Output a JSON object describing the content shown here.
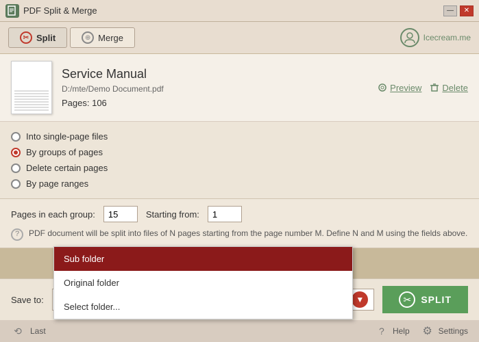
{
  "window": {
    "title": "PDF Split & Merge",
    "app_icon": "PDF",
    "minimize_label": "—",
    "close_label": "✕"
  },
  "tabs": {
    "split_label": "Split",
    "merge_label": "Merge"
  },
  "user": {
    "label": "Icecream.me"
  },
  "file": {
    "title": "Service Manual",
    "path": "D:/mte/Demo Document.pdf",
    "pages_label": "Pages: 106",
    "preview_label": "Preview",
    "delete_label": "Delete"
  },
  "split_options": {
    "option1_label": "Into single-page files",
    "option2_label": "By groups of pages",
    "option3_label": "Delete certain pages",
    "option4_label": "By page ranges"
  },
  "groups_settings": {
    "pages_in_each_group_label": "Pages in each group:",
    "pages_value": "15",
    "starting_from_label": "Starting from:",
    "starting_value": "1",
    "info_text": "PDF document will be split into files of N pages starting from the page number M. Define N and M using the fields above."
  },
  "save_bar": {
    "save_to_label": "Save to:",
    "dropdown_value": "Sub folder",
    "split_btn_label": "SPLIT"
  },
  "dropdown_menu": {
    "items": [
      {
        "label": "Sub folder",
        "selected": true
      },
      {
        "label": "Original folder",
        "selected": false
      },
      {
        "label": "Select folder...",
        "selected": false
      }
    ]
  },
  "status_bar": {
    "last_label": "Last",
    "help_label": "Help",
    "settings_label": "Settings"
  }
}
